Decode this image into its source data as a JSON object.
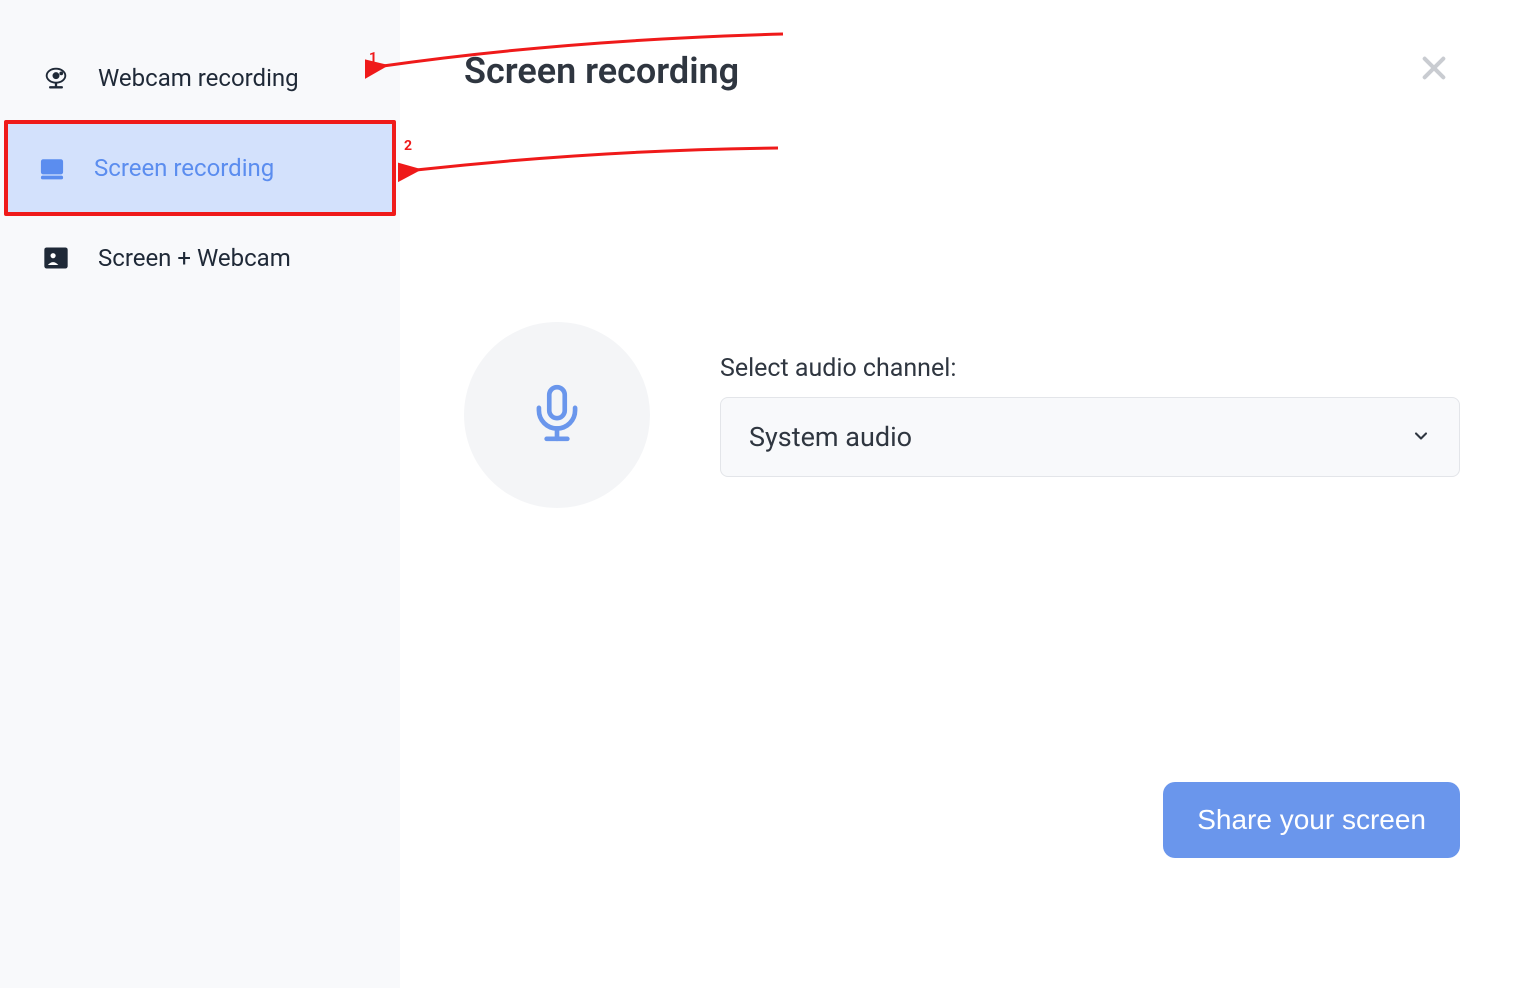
{
  "sidebar": {
    "items": [
      {
        "label": "Webcam recording",
        "icon": "webcam-icon"
      },
      {
        "label": "Screen recording",
        "icon": "screen-icon"
      },
      {
        "label": "Screen + Webcam",
        "icon": "screen-webcam-icon"
      }
    ],
    "activeIndex": 1
  },
  "main": {
    "title": "Screen recording",
    "audioLabel": "Select audio channel:",
    "audioSelected": "System audio",
    "shareButton": "Share your screen"
  },
  "annotations": {
    "arrow1": "1",
    "arrow2": "2"
  }
}
